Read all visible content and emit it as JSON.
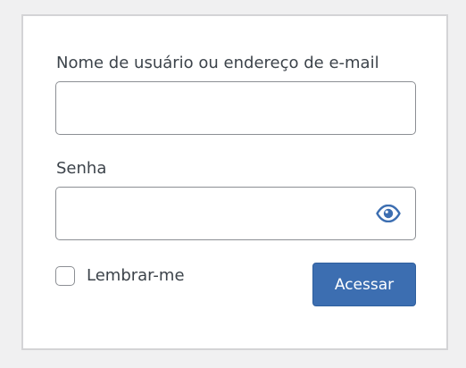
{
  "form": {
    "username_label": "Nome de usuário ou endereço de e-mail",
    "username_value": "",
    "password_label": "Senha",
    "password_value": "",
    "password_toggle_icon": "eye-icon",
    "remember_label": "Lembrar-me",
    "remember_checked": false,
    "submit_label": "Acessar"
  },
  "colors": {
    "page_background": "#f0f0f1",
    "card_background": "#ffffff",
    "accent": "#3c6eb1",
    "text": "#3c434a",
    "input_border": "#8c8f94"
  }
}
